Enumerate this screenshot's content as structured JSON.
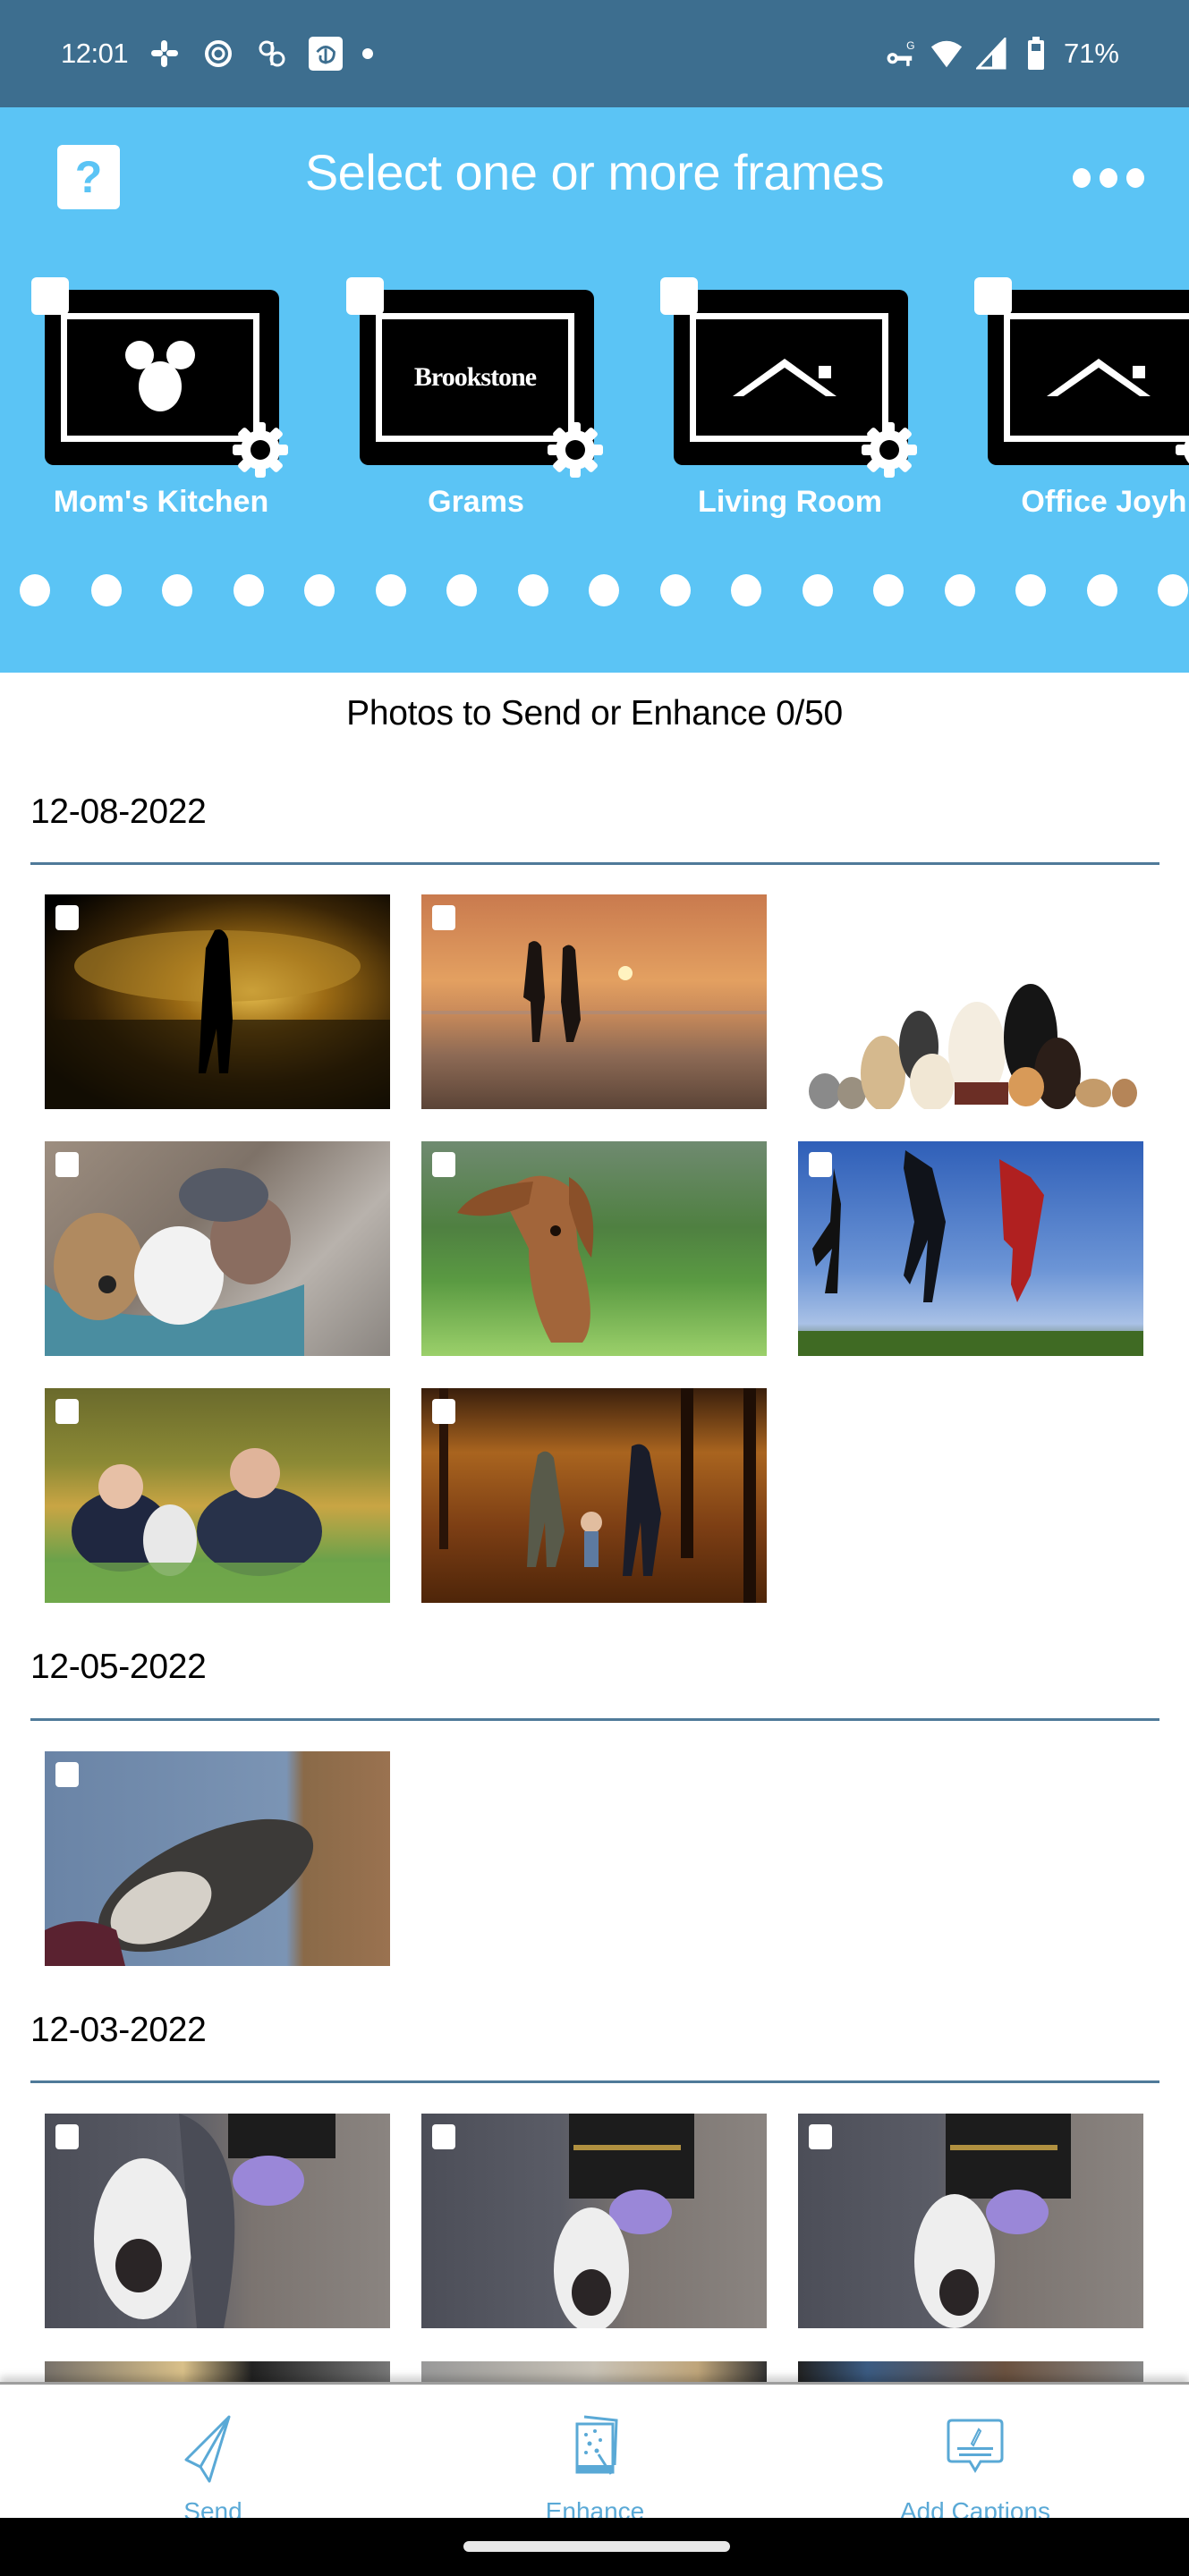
{
  "status_bar": {
    "time": "12:01",
    "left_icons": [
      "slack-icon",
      "circle-app-icon",
      "pinwheel-icon",
      "disney-plus-icon",
      "notification-dot-icon"
    ],
    "right_icons": [
      "vpn-key-icon",
      "wifi-icon",
      "cell-signal-icon",
      "battery-icon"
    ],
    "battery": "71%"
  },
  "header": {
    "help_icon": "question-mark-icon",
    "title": "Select one or more frames",
    "more_icon": "more-dots-icon",
    "background": "#5bc4f5"
  },
  "frames": [
    {
      "label": "Mom's Kitchen",
      "logo": "mickey-icon",
      "checked": false
    },
    {
      "label": "Grams",
      "logo": "brookstone-logo",
      "logo_text": "Brookstone",
      "checked": false
    },
    {
      "label": "Living Room",
      "logo": "house-roof-icon",
      "checked": false
    },
    {
      "label": "Office Joyh",
      "logo": "house-roof-icon",
      "checked": false
    }
  ],
  "pager": {
    "dot_count": 17
  },
  "photos_counter": "Photos to Send or Enhance 0/50",
  "groups": [
    {
      "date": "12-08-2022",
      "photos": [
        {
          "subject": "Couple kissing silhouette at golden sunset beach",
          "checkbox": true
        },
        {
          "subject": "Couple holding hands walking on beach at sunset",
          "checkbox": true
        },
        {
          "subject": "Group of dogs, cats and rabbits on white background",
          "checkbox": false
        },
        {
          "subject": "Puppies sleeping in blue pet bed",
          "checkbox": true
        },
        {
          "subject": "Dachshund puppy running on grass",
          "checkbox": true
        },
        {
          "subject": "Three people jumping against blue sky",
          "checkbox": true
        },
        {
          "subject": "Family lying on blanket in autumn leaves",
          "checkbox": true
        },
        {
          "subject": "Family walking in autumn forest",
          "checkbox": true
        }
      ]
    },
    {
      "date": "12-05-2022",
      "photos": [
        {
          "subject": "Husky sleeping on blue bedspread",
          "checkbox": true
        }
      ]
    },
    {
      "date": "12-03-2022",
      "photos": [
        {
          "subject": "Husky peeking from under blanket",
          "checkbox": true
        },
        {
          "subject": "Husky peeking from under blanket",
          "checkbox": true
        },
        {
          "subject": "Husky peeking from under blanket",
          "checkbox": true
        }
      ]
    }
  ],
  "bottom_nav": [
    {
      "label": "Send",
      "icon": "paper-plane-icon"
    },
    {
      "label": "Enhance",
      "icon": "magic-enhance-icon"
    },
    {
      "label": "Add Captions",
      "icon": "caption-bubble-icon"
    }
  ],
  "colors": {
    "status_bar": "#3d6e8f",
    "header": "#5bc4f5",
    "divider": "#4f7a99",
    "nav_accent": "#5aa9d6"
  }
}
